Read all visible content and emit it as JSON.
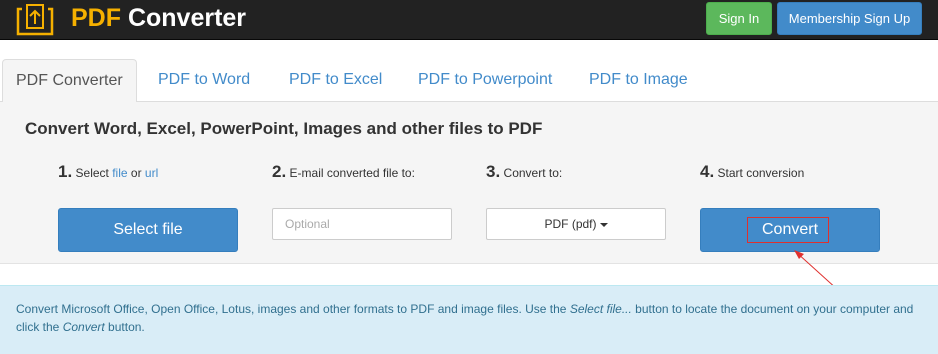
{
  "header": {
    "brand_prefix": "PDF",
    "brand_suffix": " Converter",
    "sign_in_label": "Sign In",
    "membership_label": "Membership Sign Up",
    "logo_icon": "pdf-document-upload-icon"
  },
  "tabs": [
    {
      "label": "PDF Converter",
      "active": true
    },
    {
      "label": "PDF to Word",
      "active": false
    },
    {
      "label": "PDF to Excel",
      "active": false
    },
    {
      "label": "PDF to Powerpoint",
      "active": false
    },
    {
      "label": "PDF to Image",
      "active": false
    }
  ],
  "converter": {
    "title": "Convert Word, Excel, PowerPoint, Images and other files to PDF",
    "step1": {
      "number": "1.",
      "text_before": "Select ",
      "link_file": "file",
      "text_middle": " or ",
      "link_url": "url"
    },
    "step2": {
      "number": "2.",
      "text": "E-mail converted file to:"
    },
    "step3": {
      "number": "3.",
      "text": "Convert to:"
    },
    "step4": {
      "number": "4.",
      "text": "Start conversion"
    },
    "select_button_label": "Select file",
    "email_placeholder": "Optional",
    "email_value": "",
    "format_selected": "PDF (pdf)",
    "convert_button_label": "Convert"
  },
  "info": {
    "part1": "Convert Microsoft Office, Open Office, Lotus, images and other formats to PDF and image files. Use the ",
    "em1": "Select file...",
    "part2": " button to locate the document on your computer and click the ",
    "em2": "Convert",
    "part3": " button."
  },
  "colors": {
    "navbar": "#222222",
    "brand_accent": "#f5b000",
    "primary": "#428bca",
    "success": "#5cb85c",
    "panel": "#f5f5f5",
    "info_bg": "#d9edf7",
    "info_text": "#31708f",
    "annotation": "#e0302e"
  }
}
